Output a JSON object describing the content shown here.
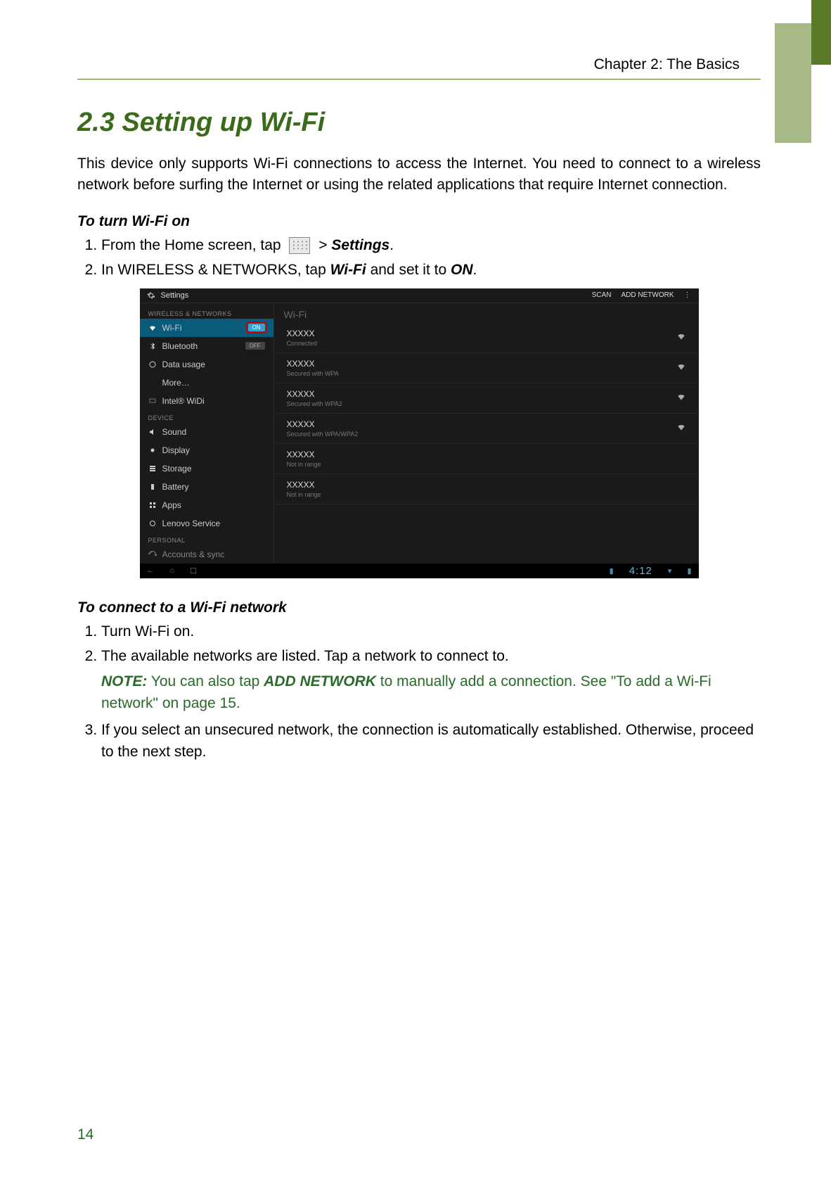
{
  "chapter_header": "Chapter 2: The Basics",
  "section_title": "2.3 Setting up Wi-Fi",
  "intro": "This device only supports Wi-Fi connections to access the Internet. You need to connect to a wireless network before surfing the Internet or using the related applications that require Internet connection.",
  "sub1": "To turn Wi-Fi on",
  "step1_a": "From the Home screen, tap ",
  "step1_b": " > ",
  "step1_settings": "Settings",
  "step1_c": ".",
  "step2_a": "In WIRELESS & NETWORKS, tap ",
  "step2_wifi": "Wi-Fi",
  "step2_b": " and set it to ",
  "step2_on": "ON",
  "step2_c": ".",
  "sub2": "To connect to a Wi-Fi network",
  "connect_steps": {
    "s1": "Turn Wi-Fi on.",
    "s2": "The available networks are listed. Tap a network to connect to.",
    "s3": "If you select an unsecured network, the connection is automatically established. Otherwise, proceed to the next step."
  },
  "note_label": "NOTE:",
  "note_text1": "  You can also tap ",
  "note_bold": "ADD NETWORK",
  "note_text2": " to manually add a connection. See \"To add a Wi-Fi network\" on page 15.",
  "page_number": "14",
  "screenshot": {
    "title": "Settings",
    "actions": {
      "scan": "SCAN",
      "add": "ADD NETWORK"
    },
    "cat_wireless": "WIRELESS & NETWORKS",
    "cat_device": "DEVICE",
    "cat_personal": "PERSONAL",
    "items": {
      "wifi": "Wi-Fi",
      "bluetooth": "Bluetooth",
      "data": "Data usage",
      "more": "More…",
      "widi": "Intel® WiDi",
      "sound": "Sound",
      "display": "Display",
      "storage": "Storage",
      "battery": "Battery",
      "apps": "Apps",
      "lenovo": "Lenovo Service",
      "accounts": "Accounts & sync"
    },
    "toggle_on": "ON",
    "toggle_off": "OFF",
    "panel_title": "Wi-Fi",
    "networks": [
      {
        "name": "XXXXX",
        "sub": "Connected",
        "sig": true
      },
      {
        "name": "XXXXX",
        "sub": "Secured with WPA",
        "sig": true
      },
      {
        "name": "XXXXX",
        "sub": "Secured with WPA2",
        "sig": true
      },
      {
        "name": "XXXXX",
        "sub": "Secured with WPA/WPA2",
        "sig": true
      },
      {
        "name": "XXXXX",
        "sub": "Not in range",
        "sig": false
      },
      {
        "name": "XXXXX",
        "sub": "Not in range",
        "sig": false
      }
    ],
    "clock": "4:12"
  }
}
